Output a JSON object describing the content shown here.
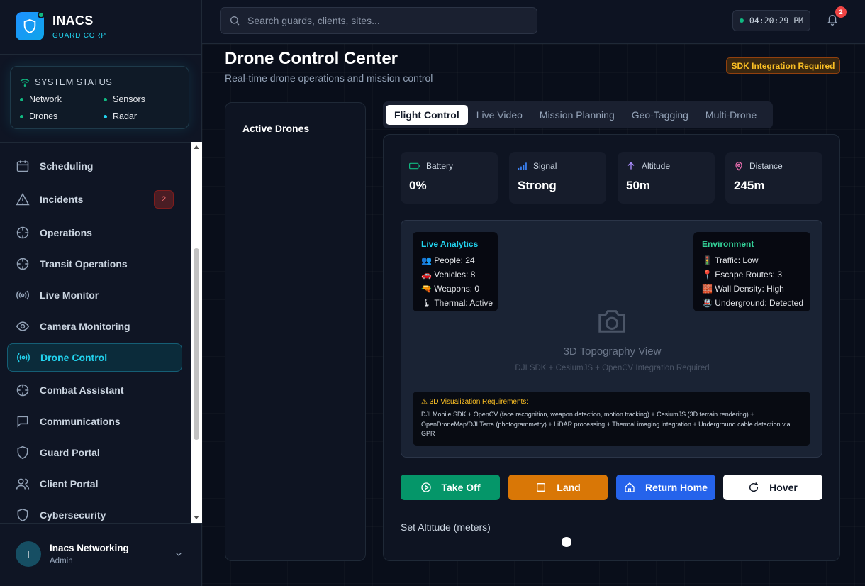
{
  "brand": {
    "name": "INACS",
    "subtitle": "GUARD CORP"
  },
  "system_status": {
    "title": "SYSTEM STATUS",
    "items": [
      {
        "label": "Network",
        "color": "#10b981"
      },
      {
        "label": "Sensors",
        "color": "#10b981"
      },
      {
        "label": "Drones",
        "color": "#10b981"
      },
      {
        "label": "Radar",
        "color": "#22d3ee"
      }
    ]
  },
  "sidebar": {
    "items": [
      {
        "label": "Scheduling",
        "icon": "calendar-icon"
      },
      {
        "label": "Incidents",
        "icon": "alert-triangle-icon",
        "badge": "2"
      },
      {
        "label": "Operations",
        "icon": "crosshair-icon"
      },
      {
        "label": "Transit Operations",
        "icon": "crosshair-icon"
      },
      {
        "label": "Live Monitor",
        "icon": "radio-icon"
      },
      {
        "label": "Camera Monitoring",
        "icon": "eye-icon"
      },
      {
        "label": "Drone Control",
        "icon": "radio-icon",
        "active": true
      },
      {
        "label": "Combat Assistant",
        "icon": "crosshair-icon"
      },
      {
        "label": "Communications",
        "icon": "message-icon"
      },
      {
        "label": "Guard Portal",
        "icon": "shield-icon"
      },
      {
        "label": "Client Portal",
        "icon": "users-icon"
      },
      {
        "label": "Cybersecurity",
        "icon": "shield-icon"
      }
    ]
  },
  "user": {
    "initial": "I",
    "name": "Inacs Networking",
    "role": "Admin"
  },
  "topbar": {
    "search_placeholder": "Search guards, clients, sites...",
    "time": "04:20:29 PM",
    "notifications": "2"
  },
  "page": {
    "title": "Drone Control Center",
    "subtitle": "Real-time drone operations and mission control",
    "sdk_badge": "SDK Integration Required"
  },
  "drones_panel": {
    "title": "Active Drones"
  },
  "tabs": [
    "Flight Control",
    "Live Video",
    "Mission Planning",
    "Geo-Tagging",
    "Multi-Drone"
  ],
  "stats": [
    {
      "label": "Battery",
      "value": "0%",
      "icon": "battery-icon",
      "color": "#10b981"
    },
    {
      "label": "Signal",
      "value": "Strong",
      "icon": "signal-icon",
      "color": "#3b82f6"
    },
    {
      "label": "Altitude",
      "value": "50m",
      "icon": "arrow-up-icon",
      "color": "#a78bfa"
    },
    {
      "label": "Distance",
      "value": "245m",
      "icon": "map-pin-icon",
      "color": "#f472b6"
    }
  ],
  "analytics": {
    "title": "Live Analytics",
    "lines": [
      "👥 People: 24",
      "🚗 Vehicles: 8",
      "🔫 Weapons: 0",
      "🌡 Thermal: Active"
    ]
  },
  "environment": {
    "title": "Environment",
    "lines": [
      "🚦 Traffic: Low",
      "📍 Escape Routes: 3",
      "🧱 Wall Density: High",
      "🚇 Underground: Detected"
    ]
  },
  "topography": {
    "title": "3D Topography View",
    "subtitle": "DJI SDK + CesiumJS + OpenCV Integration Required"
  },
  "requirements": {
    "title": "⚠ 3D Visualization Requirements:",
    "text": "DJI Mobile SDK + OpenCV (face recognition, weapon detection, motion tracking) + CesiumJS (3D terrain rendering) + OpenDroneMap/DJI Terra (photogrammetry) + LiDAR processing + Thermal imaging integration + Underground cable detection via GPR"
  },
  "buttons": [
    {
      "label": "Take Off",
      "icon": "play-circle-icon",
      "color": "#059669"
    },
    {
      "label": "Land",
      "icon": "square-icon",
      "color": "#d97706"
    },
    {
      "label": "Return Home",
      "icon": "home-icon",
      "color": "#2563eb"
    },
    {
      "label": "Hover",
      "icon": "rotate-icon",
      "color": "#ffffff"
    }
  ],
  "altitude_control": {
    "label": "Set Altitude (meters)"
  }
}
